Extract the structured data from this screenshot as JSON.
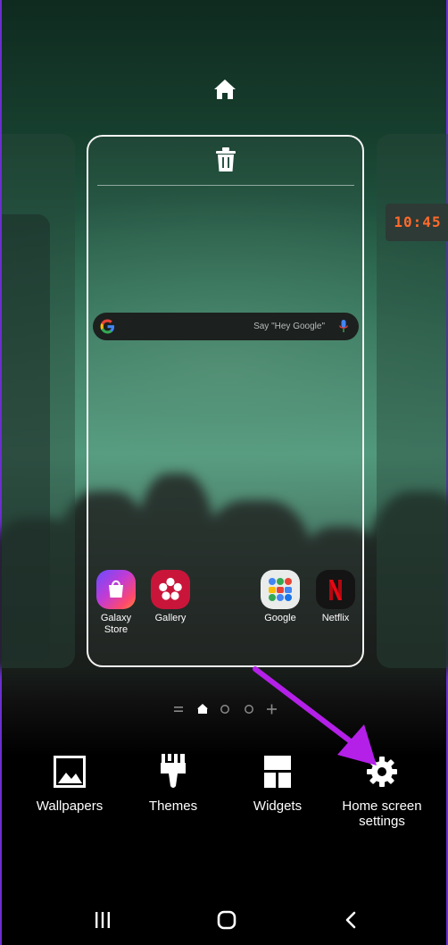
{
  "clock": {
    "time": "10:45"
  },
  "search": {
    "hint": "Say \"Hey Google\""
  },
  "apps": [
    {
      "label": "Galaxy Store"
    },
    {
      "label": "Gallery"
    },
    {
      "label": "Google"
    },
    {
      "label": "Netflix"
    }
  ],
  "menu": {
    "wallpapers": "Wallpapers",
    "themes": "Themes",
    "widgets": "Widgets",
    "home_settings": "Home screen settings"
  },
  "icons": {
    "home": "home-icon",
    "trash": "trash-icon",
    "wallpapers": "image-icon",
    "themes": "paintbrush-icon",
    "widgets": "widgets-icon",
    "settings": "gear-icon",
    "nav_recents": "recents-icon",
    "nav_home": "nav-home-icon",
    "nav_back": "back-icon"
  },
  "colors": {
    "accent_arrow": "#b420e8",
    "clock_digits": "#ff6a2b",
    "netflix_red": "#e50914"
  }
}
